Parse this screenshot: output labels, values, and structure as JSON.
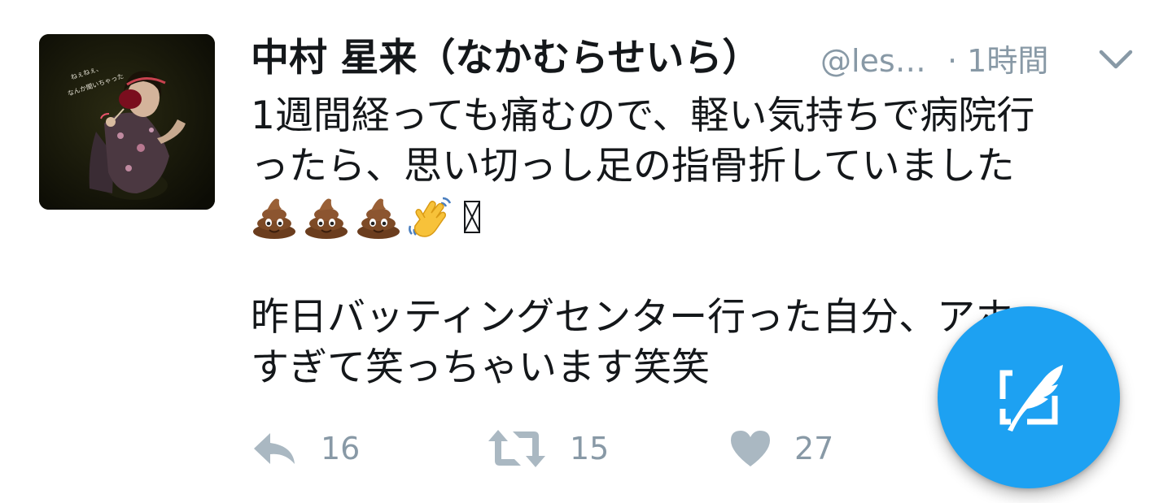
{
  "tweet": {
    "display_name": "中村 星来（なかむらせいら）",
    "handle": "@les…",
    "time": "· 1時間",
    "lines": [
      "1週間経っても痛むので、軽い気持ちで病院行",
      "ったら、思い切っし足の指骨折していました"
    ],
    "emojis": [
      "pile-of-poo",
      "pile-of-poo",
      "pile-of-poo",
      "waving-hand",
      "missing-glyph"
    ],
    "lines2": [
      "昨日バッティングセンター行った自分、アホ",
      "すぎて笑っちゃいます笑笑"
    ],
    "avatar_text": [
      "ねぇねぇ、",
      "なんか聞いちゃった"
    ]
  },
  "actions": {
    "reply_count": "16",
    "retweet_count": "15",
    "like_count": "27"
  },
  "icons": {
    "reply": "reply-icon",
    "retweet": "retweet-icon",
    "like": "heart-icon",
    "menu": "chevron-down-icon",
    "compose": "compose-feather-icon"
  },
  "colors": {
    "text": "#14171a",
    "muted": "#8899a6",
    "action_icon": "#aab8c2",
    "accent": "#1da1f2"
  }
}
